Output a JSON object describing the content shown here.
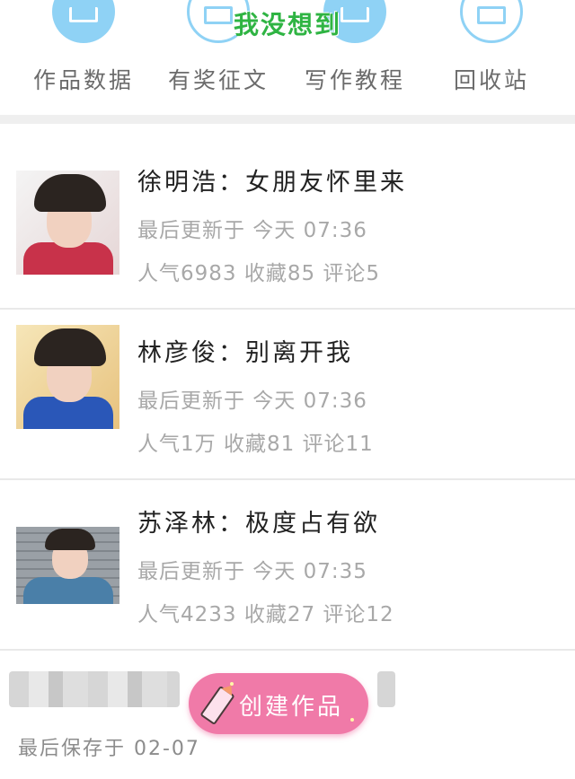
{
  "overlay": {
    "caption": "我没想到"
  },
  "nav": {
    "items": [
      {
        "label": "作品数据",
        "icon": "chart-icon"
      },
      {
        "label": "有奖征文",
        "icon": "medal-icon"
      },
      {
        "label": "写作教程",
        "icon": "book-icon"
      },
      {
        "label": "回收站",
        "icon": "trash-icon"
      }
    ]
  },
  "works": [
    {
      "title": "徐明浩：女朋友怀里来",
      "updated": "最后更新于 今天 07:36",
      "stats": "人气6983 收藏85 评论5",
      "thumb_colors": [
        "#c8324a",
        "#f2f2f2"
      ]
    },
    {
      "title": "林彦俊：别离开我",
      "updated": "最后更新于 今天 07:36",
      "stats": "人气1万 收藏81 评论11",
      "thumb_colors": [
        "#2a57b8",
        "#f3d89c"
      ]
    },
    {
      "title": "苏泽林：极度占有欲",
      "updated": "最后更新于 今天 07:35",
      "stats": "人气4233 收藏27 评论12",
      "thumb_colors": [
        "#4a7fa8",
        "#8a8f96"
      ]
    }
  ],
  "draft": {
    "saved": "最后保存于 02-07"
  },
  "create_button": {
    "label": "创建作品"
  },
  "colors": {
    "accent_blue": "#8fd2f5",
    "button_pink": "#f07aa8",
    "caption_green": "#2fb443"
  }
}
